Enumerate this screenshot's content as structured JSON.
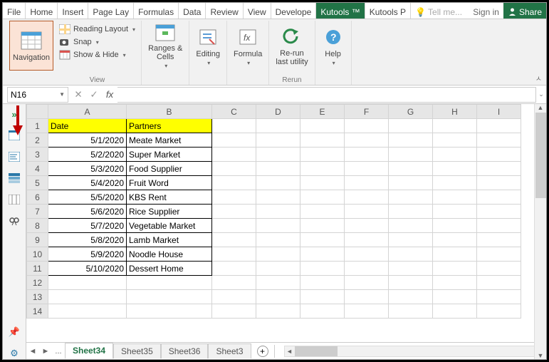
{
  "tabs": [
    "File",
    "Home",
    "Insert",
    "Page Lay",
    "Formulas",
    "Data",
    "Review",
    "View",
    "Develope",
    "Kutools ™",
    "Kutools P",
    "Tell me..."
  ],
  "activeTab": 9,
  "signin": "Sign in",
  "share": "Share",
  "ribbon": {
    "nav": "Navigation",
    "reading": "Reading Layout",
    "snap": "Snap",
    "showhide": "Show & Hide",
    "view": "View",
    "ranges": "Ranges &\nCells",
    "editing": "Editing",
    "formula": "Formula",
    "rerun": "Re-run\nlast utility",
    "rerunGroup": "Rerun",
    "help": "Help"
  },
  "namebox": "N16",
  "fx": "fx",
  "columns": [
    "A",
    "B",
    "C",
    "D",
    "E",
    "F",
    "G",
    "H",
    "I"
  ],
  "headers": {
    "A": "Date",
    "B": "Partners"
  },
  "rows": [
    {
      "n": 1
    },
    {
      "n": 2,
      "A": "5/1/2020",
      "B": "Meate Market"
    },
    {
      "n": 3,
      "A": "5/2/2020",
      "B": "Super Market"
    },
    {
      "n": 4,
      "A": "5/3/2020",
      "B": "Food Supplier"
    },
    {
      "n": 5,
      "A": "5/4/2020",
      "B": "Fruit Word"
    },
    {
      "n": 6,
      "A": "5/5/2020",
      "B": "KBS Rent"
    },
    {
      "n": 7,
      "A": "5/6/2020",
      "B": "Rice Supplier"
    },
    {
      "n": 8,
      "A": "5/7/2020",
      "B": "Vegetable Market"
    },
    {
      "n": 9,
      "A": "5/8/2020",
      "B": "Lamb Market"
    },
    {
      "n": 10,
      "A": "5/9/2020",
      "B": "Noodle House"
    },
    {
      "n": 11,
      "A": "5/10/2020",
      "B": "Dessert Home"
    },
    {
      "n": 12
    },
    {
      "n": 13
    },
    {
      "n": 14
    }
  ],
  "sheets": {
    "active": "Sheet34",
    "others": [
      "Sheet35",
      "Sheet36",
      "Sheet3"
    ],
    "dots": "..."
  }
}
